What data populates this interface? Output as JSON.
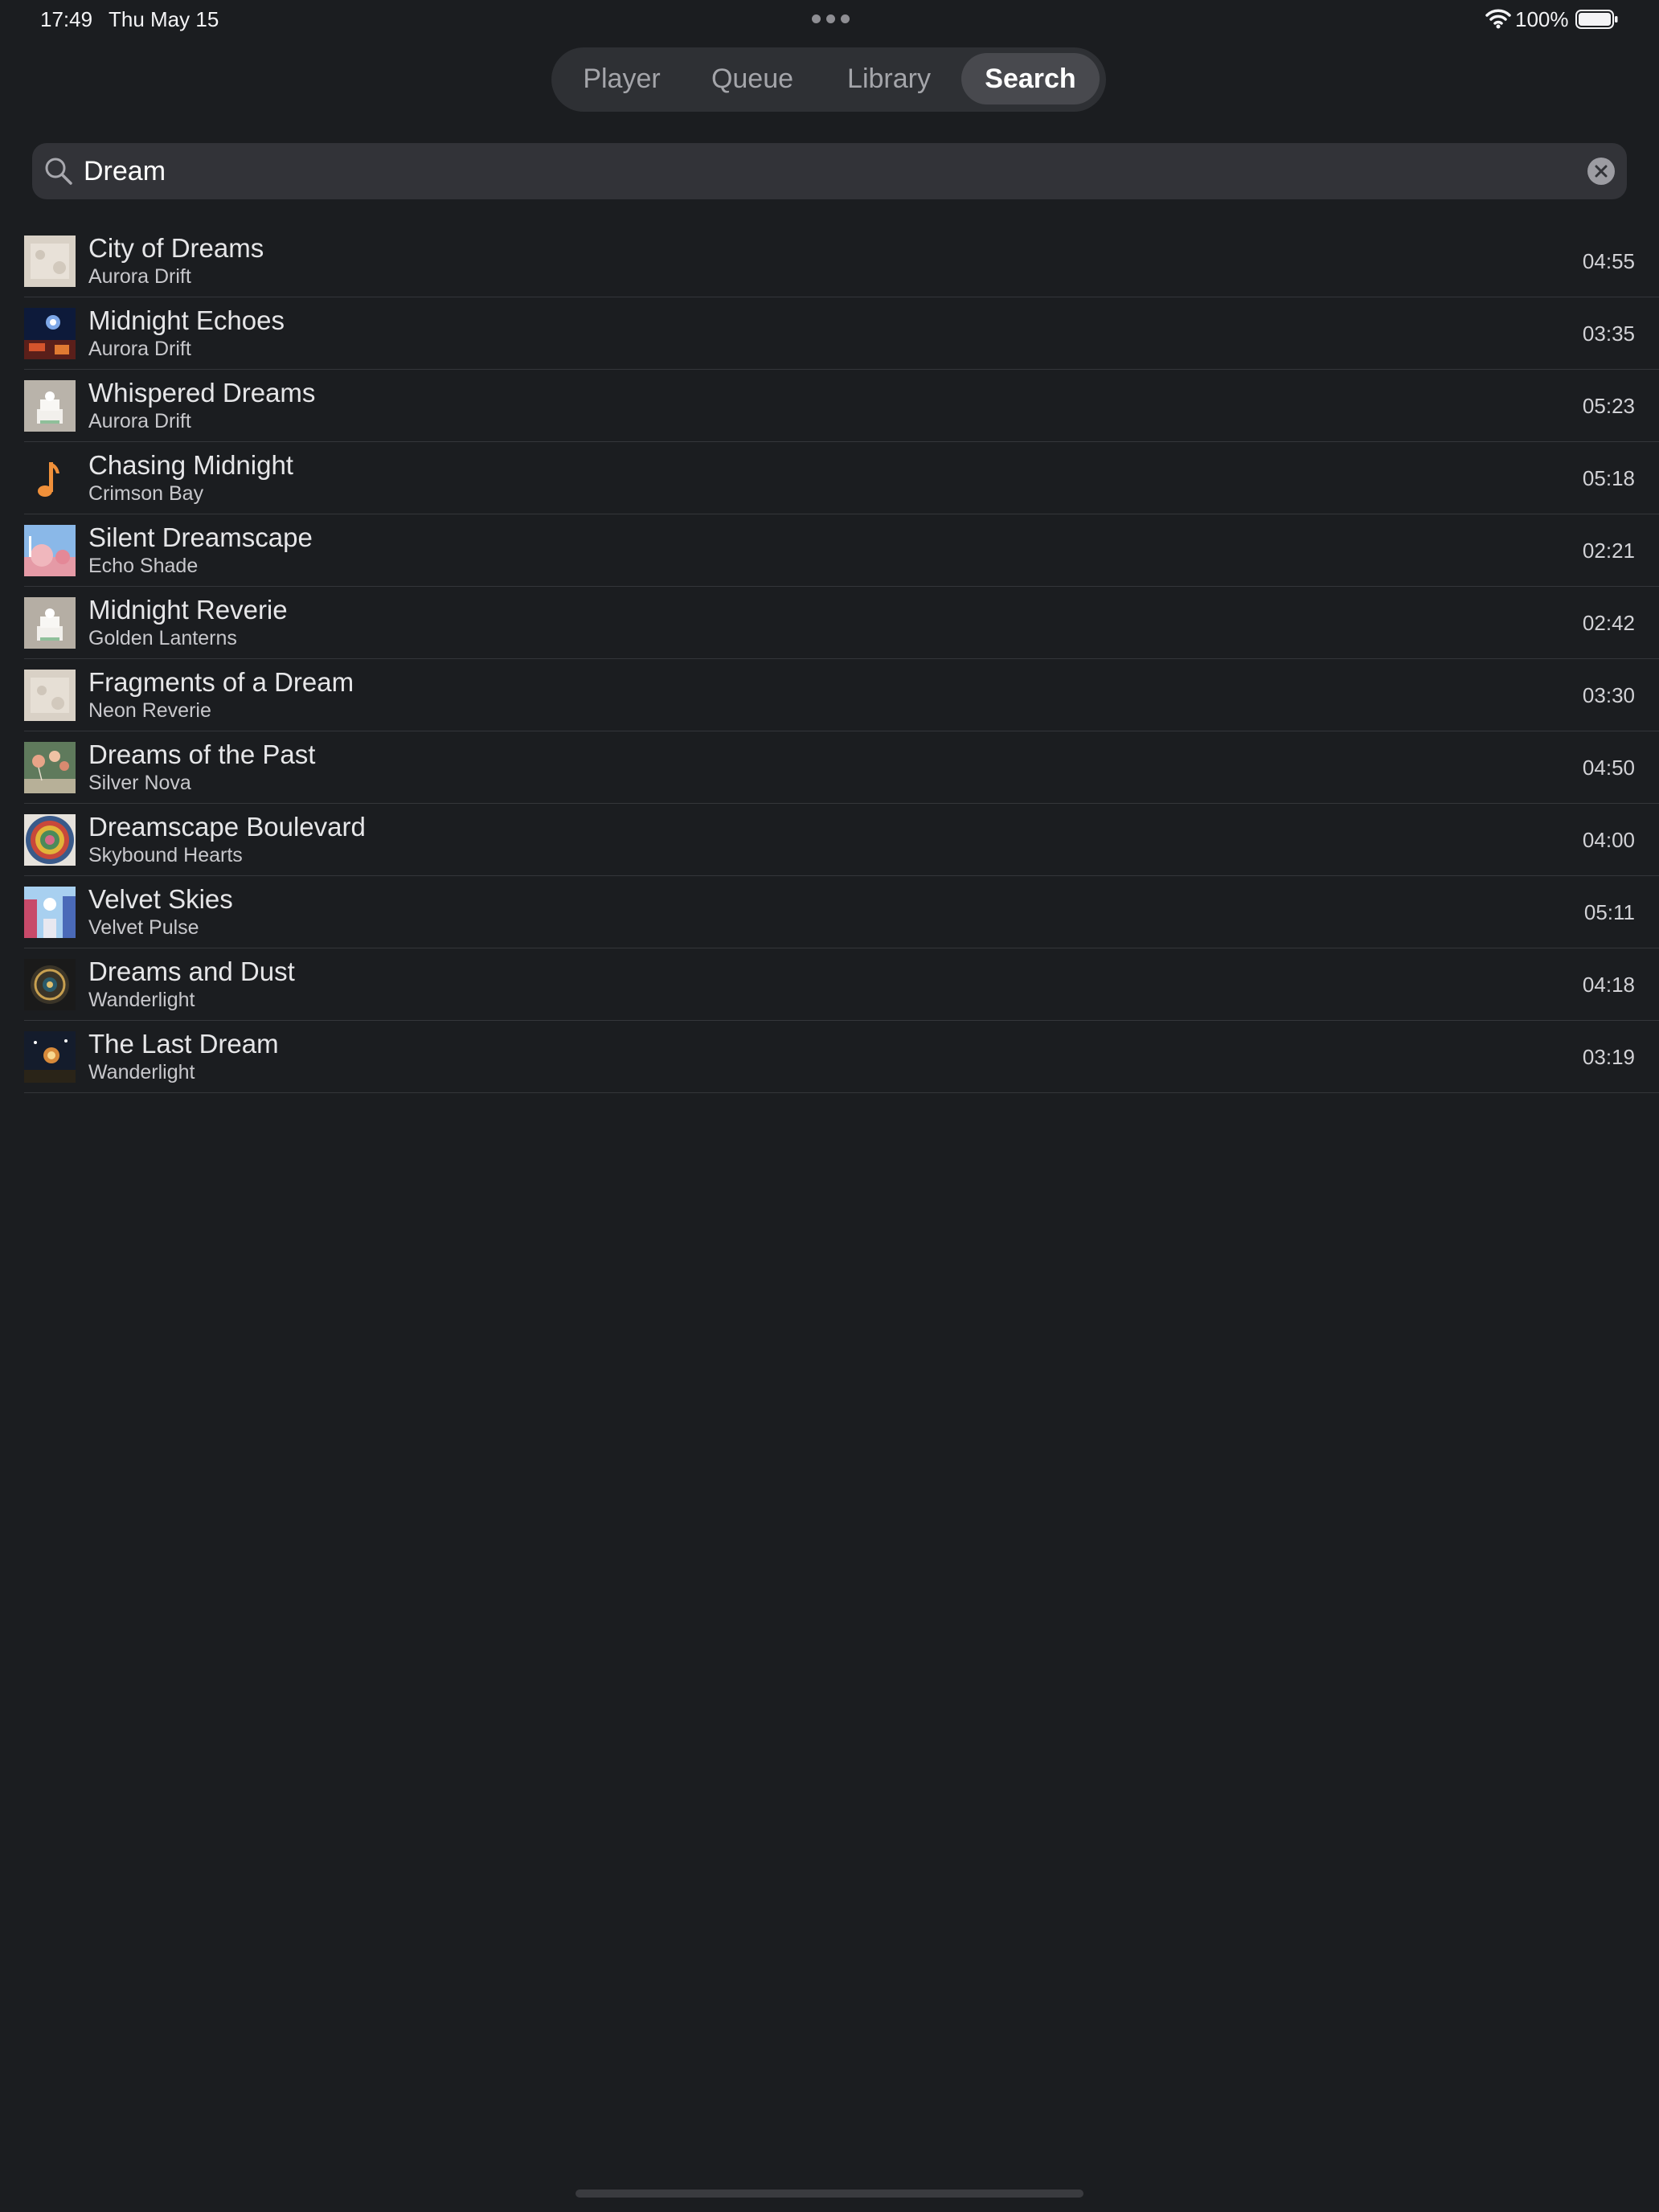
{
  "status_bar": {
    "time": "17:49",
    "date": "Thu May 15",
    "battery": "100%"
  },
  "tabs": [
    {
      "label": "Player"
    },
    {
      "label": "Queue"
    },
    {
      "label": "Library"
    },
    {
      "label": "Search",
      "selected": true
    }
  ],
  "search": {
    "value": "Dream",
    "icon": "search-icon",
    "clear_icon": "clear-icon"
  },
  "results": [
    {
      "title": "City of Dreams",
      "artist": "Aurora Drift",
      "duration": "04:55",
      "artwork": "pale-beige-texture"
    },
    {
      "title": "Midnight Echoes",
      "artist": "Aurora Drift",
      "duration": "03:35",
      "artwork": "night-sky-city"
    },
    {
      "title": "Whispered Dreams",
      "artist": "Aurora Drift",
      "duration": "05:23",
      "artwork": "white-cake"
    },
    {
      "title": "Chasing Midnight",
      "artist": "Crimson Bay",
      "duration": "05:18",
      "artwork": "music-note-icon"
    },
    {
      "title": "Silent Dreamscape",
      "artist": "Echo Shade",
      "duration": "02:21",
      "artwork": "pink-landscape"
    },
    {
      "title": "Midnight Reverie",
      "artist": "Golden Lanterns",
      "duration": "02:42",
      "artwork": "white-cake"
    },
    {
      "title": "Fragments of a Dream",
      "artist": "Neon Reverie",
      "duration": "03:30",
      "artwork": "pale-beige-texture"
    },
    {
      "title": "Dreams of the Past",
      "artist": "Silver Nova",
      "duration": "04:50",
      "artwork": "green-balloons"
    },
    {
      "title": "Dreamscape Boulevard",
      "artist": "Skybound Hearts",
      "duration": "04:00",
      "artwork": "colorful-mosaic-circle"
    },
    {
      "title": "Velvet Skies",
      "artist": "Velvet Pulse",
      "duration": "05:11",
      "artwork": "blue-street"
    },
    {
      "title": "Dreams and Dust",
      "artist": "Wanderlight",
      "duration": "04:18",
      "artwork": "dark-medallion"
    },
    {
      "title": "The Last Dream",
      "artist": "Wanderlight",
      "duration": "03:19",
      "artwork": "dark-fireworks"
    }
  ],
  "colors": {
    "background": "#1b1d20",
    "accent": "#f0903a",
    "selected_tab": "#48494e"
  }
}
